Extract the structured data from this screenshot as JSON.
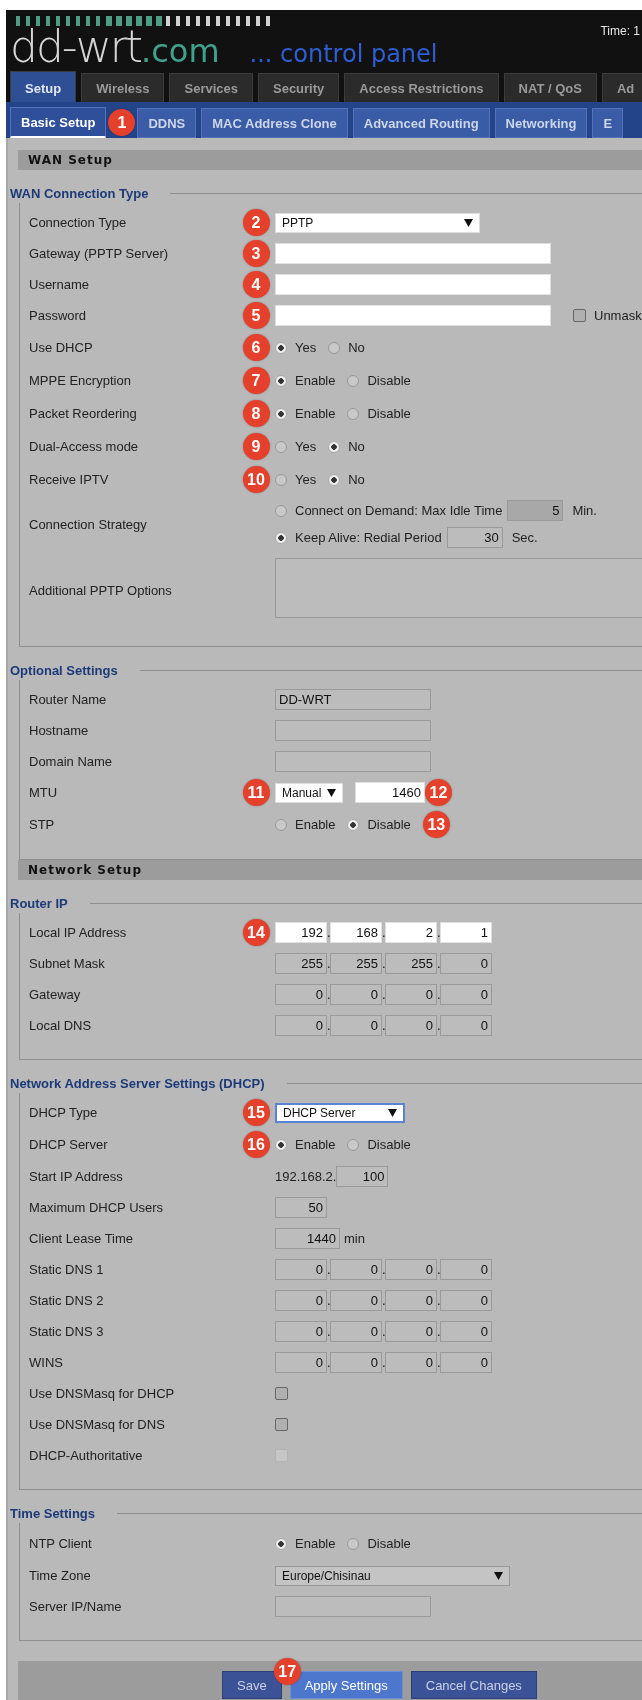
{
  "header": {
    "logo": "dd-wrt",
    "logo_domain": ".com",
    "subtitle": "... control panel",
    "time": "Time: 1"
  },
  "tabs": [
    {
      "label": "Setup",
      "selected": true
    },
    {
      "label": "Wireless",
      "selected": false
    },
    {
      "label": "Services",
      "selected": false
    },
    {
      "label": "Security",
      "selected": false
    },
    {
      "label": "Access Restrictions",
      "selected": false
    },
    {
      "label": "NAT / QoS",
      "selected": false
    },
    {
      "label": "Ad",
      "selected": false
    }
  ],
  "subtabs": [
    {
      "label": "Basic Setup",
      "selected": true,
      "marker": "1"
    },
    {
      "label": "DDNS",
      "selected": false
    },
    {
      "label": "MAC Address Clone",
      "selected": false
    },
    {
      "label": "Advanced Routing",
      "selected": false
    },
    {
      "label": "Networking",
      "selected": false
    },
    {
      "label": "E",
      "selected": false
    }
  ],
  "sections": [
    {
      "title": "WAN Setup",
      "groups": [
        {
          "legend": "WAN Connection Type",
          "rows": [
            {
              "kind": "select",
              "label": "Connection Type",
              "marker": "2",
              "value": "PPTP",
              "highlighted": true,
              "focused": false
            },
            {
              "kind": "text",
              "label": "Gateway (PPTP Server)",
              "marker": "3",
              "highlighted": true
            },
            {
              "kind": "text",
              "label": "Username",
              "marker": "4",
              "highlighted": true
            },
            {
              "kind": "password",
              "label": "Password",
              "marker": "5",
              "highlighted": true,
              "checkbox": {
                "label": "Unmask",
                "checked": false
              }
            },
            {
              "kind": "radio",
              "label": "Use DHCP",
              "marker": "6",
              "options": [
                {
                  "label": "Yes",
                  "selected": true
                },
                {
                  "label": "No",
                  "selected": false
                }
              ]
            },
            {
              "kind": "radio",
              "label": "MPPE Encryption",
              "marker": "7",
              "options": [
                {
                  "label": "Enable",
                  "selected": true
                },
                {
                  "label": "Disable",
                  "selected": false
                }
              ]
            },
            {
              "kind": "radio",
              "label": "Packet Reordering",
              "marker": "8",
              "options": [
                {
                  "label": "Enable",
                  "selected": true
                },
                {
                  "label": "Disable",
                  "selected": false
                }
              ]
            },
            {
              "kind": "radio",
              "label": "Dual-Access mode",
              "marker": "9",
              "options": [
                {
                  "label": "Yes",
                  "selected": false
                },
                {
                  "label": "No",
                  "selected": true
                }
              ]
            },
            {
              "kind": "radio",
              "label": "Receive IPTV",
              "marker": "10",
              "options": [
                {
                  "label": "Yes",
                  "selected": false
                },
                {
                  "label": "No",
                  "selected": true
                }
              ]
            },
            {
              "kind": "strategy",
              "label": "Connection Strategy",
              "options": [
                {
                  "label": "Connect on Demand: Max Idle Time",
                  "selected": false,
                  "value": "5",
                  "disabled": true,
                  "unit": "Min."
                },
                {
                  "label": "Keep Alive: Redial Period",
                  "selected": true,
                  "value": "30",
                  "disabled": false,
                  "unit": "Sec."
                }
              ]
            },
            {
              "kind": "textarea",
              "label": "Additional PPTP Options"
            }
          ]
        },
        {
          "legend": "Optional Settings",
          "rows": [
            {
              "kind": "short_text",
              "label": "Router Name",
              "value": "DD-WRT",
              "highlighted": false
            },
            {
              "kind": "short_text",
              "label": "Hostname",
              "highlighted": false
            },
            {
              "kind": "short_text",
              "label": "Domain Name",
              "highlighted": false
            },
            {
              "kind": "mtu",
              "label": "MTU",
              "marker": "11",
              "value": "Manual",
              "number": "1460",
              "number_marker": "12",
              "highlighted": true
            },
            {
              "kind": "radio",
              "label": "STP",
              "options": [
                {
                  "label": "Enable",
                  "selected": false
                },
                {
                  "label": "Disable",
                  "selected": true
                }
              ],
              "after_marker": "13"
            }
          ]
        }
      ]
    },
    {
      "title": "Network Setup",
      "groups": [
        {
          "legend": "Router IP",
          "rows": [
            {
              "kind": "octets",
              "label": "Local IP Address",
              "marker": "14",
              "highlighted": true,
              "octets": [
                {
                  "value": "192",
                  "dot": "."
                },
                {
                  "value": "168",
                  "dot": "."
                },
                {
                  "value": "2",
                  "dot": "."
                },
                {
                  "value": "1"
                }
              ]
            },
            {
              "kind": "octets",
              "label": "Subnet Mask",
              "highlighted": false,
              "octets": [
                {
                  "value": "255",
                  "dot": "."
                },
                {
                  "value": "255",
                  "dot": "."
                },
                {
                  "value": "255",
                  "dot": "."
                },
                {
                  "value": "0"
                }
              ]
            },
            {
              "kind": "octets",
              "label": "Gateway",
              "highlighted": false,
              "octets": [
                {
                  "value": "0",
                  "dot": "."
                },
                {
                  "value": "0",
                  "dot": "."
                },
                {
                  "value": "0",
                  "dot": "."
                },
                {
                  "value": "0"
                }
              ]
            },
            {
              "kind": "octets",
              "label": "Local DNS",
              "highlighted": false,
              "octets": [
                {
                  "value": "0",
                  "dot": "."
                },
                {
                  "value": "0",
                  "dot": "."
                },
                {
                  "value": "0",
                  "dot": "."
                },
                {
                  "value": "0"
                }
              ]
            }
          ]
        },
        {
          "legend": "Network Address Server Settings (DHCP)",
          "rows": [
            {
              "kind": "select",
              "label": "DHCP Type",
              "marker": "15",
              "value": "DHCP Server",
              "highlighted": true,
              "focused": true
            },
            {
              "kind": "radio",
              "label": "DHCP Server",
              "marker": "16",
              "options": [
                {
                  "label": "Enable",
                  "selected": true
                },
                {
                  "label": "Disable",
                  "selected": false
                }
              ]
            },
            {
              "kind": "prefix",
              "label": "Start IP Address",
              "prefix": "192.168.2.",
              "value": "100"
            },
            {
              "kind": "number",
              "label": "Maximum DHCP Users",
              "value": "50"
            },
            {
              "kind": "number",
              "label": "Client Lease Time",
              "value": "1440",
              "unit": "min"
            },
            {
              "kind": "octets",
              "label": "Static DNS 1",
              "highlighted": false,
              "octets": [
                {
                  "value": "0",
                  "dot": "."
                },
                {
                  "value": "0",
                  "dot": "."
                },
                {
                  "value": "0",
                  "dot": "."
                },
                {
                  "value": "0"
                }
              ]
            },
            {
              "kind": "octets",
              "label": "Static DNS 2",
              "highlighted": false,
              "octets": [
                {
                  "value": "0",
                  "dot": "."
                },
                {
                  "value": "0",
                  "dot": "."
                },
                {
                  "value": "0",
                  "dot": "."
                },
                {
                  "value": "0"
                }
              ]
            },
            {
              "kind": "octets",
              "label": "Static DNS 3",
              "highlighted": false,
              "octets": [
                {
                  "value": "0",
                  "dot": "."
                },
                {
                  "value": "0",
                  "dot": "."
                },
                {
                  "value": "0",
                  "dot": "."
                },
                {
                  "value": "0"
                }
              ]
            },
            {
              "kind": "octets",
              "label": "WINS",
              "highlighted": false,
              "octets": [
                {
                  "value": "0",
                  "dot": "."
                },
                {
                  "value": "0",
                  "dot": "."
                },
                {
                  "value": "0",
                  "dot": "."
                },
                {
                  "value": "0"
                }
              ]
            },
            {
              "kind": "checkbox",
              "label": "Use DNSMasq for DHCP",
              "checked": false,
              "disabled": false
            },
            {
              "kind": "checkbox",
              "label": "Use DNSMasq for DNS",
              "checked": false,
              "disabled": false
            },
            {
              "kind": "checkbox",
              "label": "DHCP-Authoritative",
              "checked": false,
              "disabled": true
            }
          ]
        },
        {
          "legend": "Time Settings",
          "rows": [
            {
              "kind": "radio",
              "label": "NTP Client",
              "options": [
                {
                  "label": "Enable",
                  "selected": true
                },
                {
                  "label": "Disable",
                  "selected": false
                }
              ]
            },
            {
              "kind": "select",
              "label": "Time Zone",
              "value": "Europe/Chisinau",
              "highlighted": false,
              "focused": false
            },
            {
              "kind": "short_text",
              "label": "Server IP/Name",
              "highlighted": false
            }
          ]
        }
      ]
    }
  ],
  "buttons": [
    {
      "label": "Save",
      "primary": false
    },
    {
      "label": "Apply Settings",
      "primary": true,
      "marker": "17"
    },
    {
      "label": "Cancel Changes",
      "primary": false
    }
  ]
}
